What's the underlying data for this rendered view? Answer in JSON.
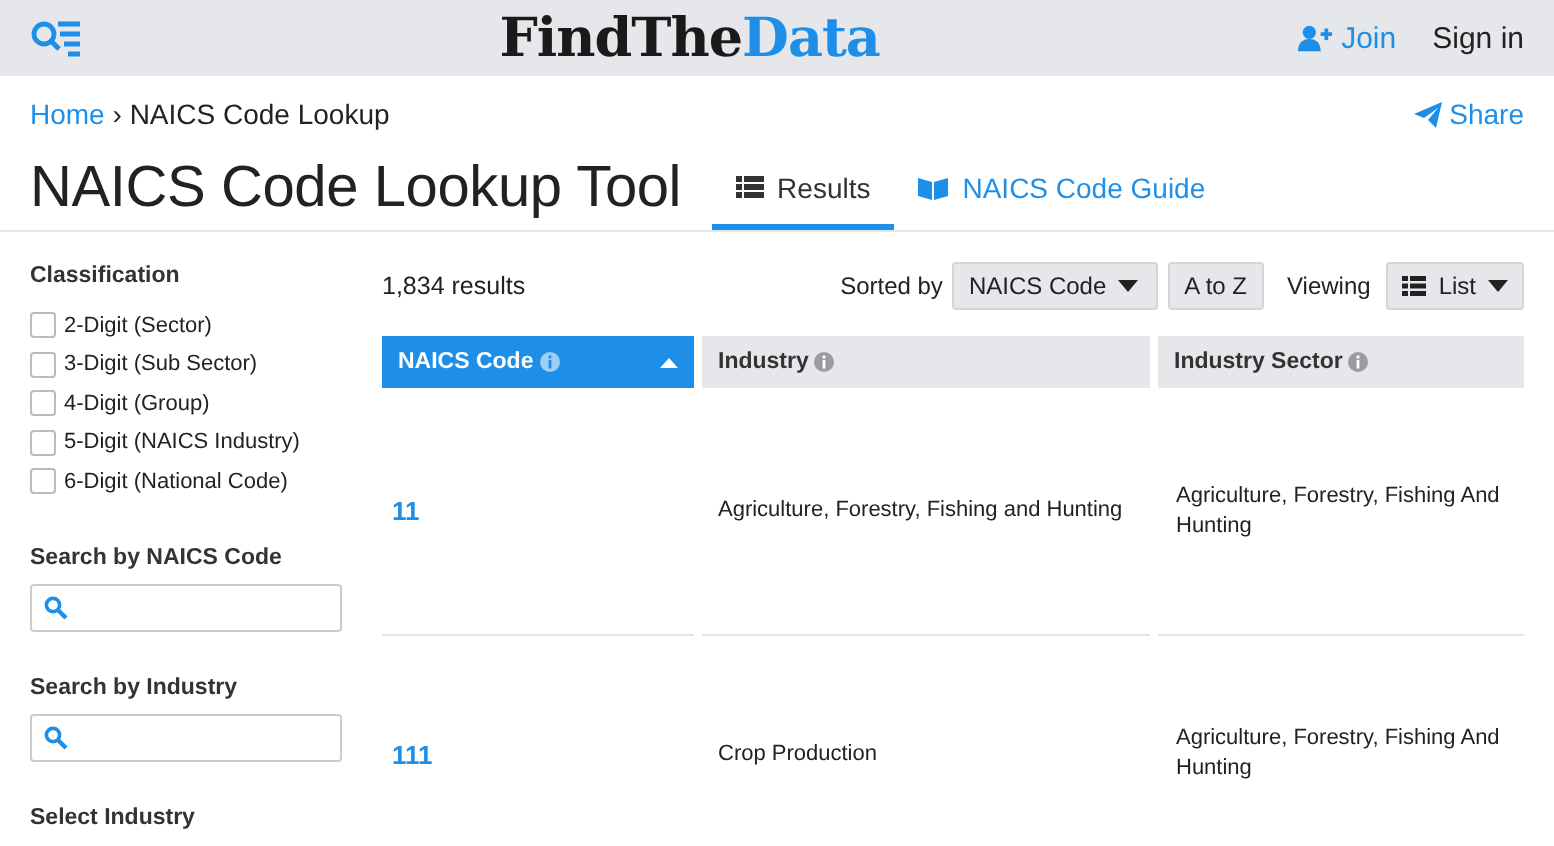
{
  "header": {
    "logo": [
      {
        "text": "FindThe",
        "color": "#1a1a1a"
      },
      {
        "text": "Data",
        "color": "#1e8fe8"
      }
    ],
    "join": "Join",
    "sign_in": "Sign in"
  },
  "breadcrumb": {
    "home": "Home",
    "separator": "›",
    "current": "NAICS Code Lookup"
  },
  "share": "Share",
  "title": "NAICS Code Lookup Tool",
  "tabs": [
    {
      "label": "Results",
      "kind": "list",
      "selected": true
    },
    {
      "label": "NAICS Code Guide",
      "kind": "book",
      "selected": false
    }
  ],
  "sidebar": {
    "classification": {
      "title": "Classification",
      "options": [
        {
          "label": "2-Digit (Sector)",
          "checked": false
        },
        {
          "label": "3-Digit (Sub Sector)",
          "checked": false
        },
        {
          "label": "4-Digit (Group)",
          "checked": false
        },
        {
          "label": "5-Digit (NAICS Industry)",
          "checked": false
        },
        {
          "label": "6-Digit (National Code)",
          "checked": false
        }
      ]
    },
    "searches": [
      {
        "title": "Search by NAICS Code"
      },
      {
        "title": "Search by Industry"
      }
    ],
    "select_title": "Select Industry"
  },
  "results": {
    "count": "1,834 results",
    "sorted_by_label": "Sorted by",
    "sort_field": "NAICS Code",
    "sort_order": "A to Z",
    "viewing_label": "Viewing",
    "view": "List"
  },
  "table": {
    "columns": [
      {
        "label": "NAICS Code",
        "selected": true
      },
      {
        "label": "Industry",
        "selected": false
      },
      {
        "label": "Industry Sector",
        "selected": false
      }
    ],
    "rows": [
      [
        "11",
        "Agriculture, Forestry, Fishing and Hunting",
        "Agriculture, Forestry, Fishing And Hunting"
      ],
      [
        "111",
        "Crop Production",
        "Agriculture, Forestry, Fishing And Hunting"
      ]
    ]
  }
}
